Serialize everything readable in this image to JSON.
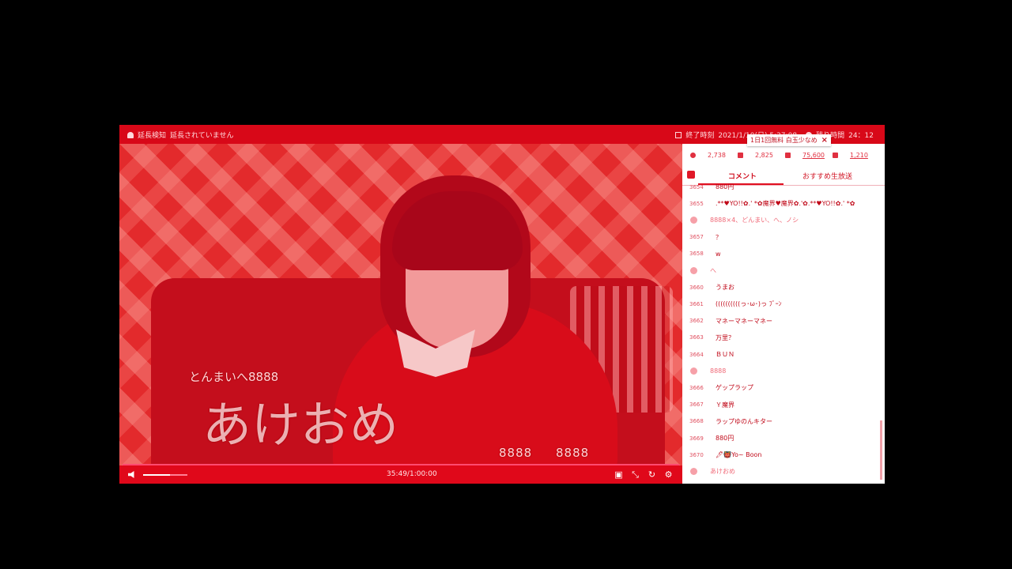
{
  "topbar": {
    "extension_label": "延長検知",
    "extension_status": "延長されていません",
    "end_time_label": "終了時刻",
    "end_time": "2021/1/10(日) 5:27:08",
    "remaining_label": "残り時間",
    "remaining": "24：12"
  },
  "toast": {
    "text": "1日1回無料 白玉少なめ",
    "close": "×"
  },
  "stats": {
    "viewers": "2,738",
    "comments": "2,825",
    "ads": "75,600",
    "gifts": "1,210"
  },
  "tabs": {
    "comment": "コメント",
    "recommended": "おすすめ生放送"
  },
  "comments": [
    {
      "num": "3654",
      "text": "880円",
      "sys": false
    },
    {
      "num": "3655",
      "text": ".**♥YO!!✿.' *✿魔界♥魔界✿.'✿.**♥YO!!✿.' *✿",
      "sys": false
    },
    {
      "num": "",
      "text": "8888×4、どんまい、へ、ノシ",
      "sys": true
    },
    {
      "num": "3657",
      "text": "？",
      "sys": false
    },
    {
      "num": "3658",
      "text": "w",
      "sys": false
    },
    {
      "num": "",
      "text": "へ",
      "sys": true
    },
    {
      "num": "3660",
      "text": "うまお",
      "sys": false
    },
    {
      "num": "3661",
      "text": "((((((((((っ･ω･)っ ﾌﾞｰﾝ",
      "sys": false
    },
    {
      "num": "3662",
      "text": "マネーマネーマネー",
      "sys": false
    },
    {
      "num": "3663",
      "text": "万里？",
      "sys": false
    },
    {
      "num": "3664",
      "text": "ＢＵＮ",
      "sys": false
    },
    {
      "num": "",
      "text": "8888",
      "sys": true
    },
    {
      "num": "3666",
      "text": "ゲップラップ",
      "sys": false
    },
    {
      "num": "3667",
      "text": "Ｙ魔界",
      "sys": false
    },
    {
      "num": "3668",
      "text": "ラップゆのんキター",
      "sys": false
    },
    {
      "num": "3669",
      "text": "880円",
      "sys": false
    },
    {
      "num": "3670",
      "text": "🖊👹Yo~ Boon",
      "sys": false
    },
    {
      "num": "",
      "text": "あけおめ",
      "sys": true
    }
  ],
  "video": {
    "danmaku_1": "とんまいへ8888",
    "danmaku_2": "あけおめ",
    "danmaku_3": "8888",
    "danmaku_4": "8888"
  },
  "controls": {
    "time": "35:49/1:00:00",
    "volume": 0.6
  },
  "colors": {
    "accent": "#e8081a",
    "sidebar_bg": "#ffffff"
  },
  "icons": [
    "bell-icon",
    "calendar-icon",
    "clock-icon",
    "viewers-icon",
    "comments-icon",
    "ad-icon",
    "gift-icon",
    "volume-icon",
    "comment-toggle-icon",
    "fullscreen-icon",
    "reload-icon",
    "settings-icon"
  ]
}
